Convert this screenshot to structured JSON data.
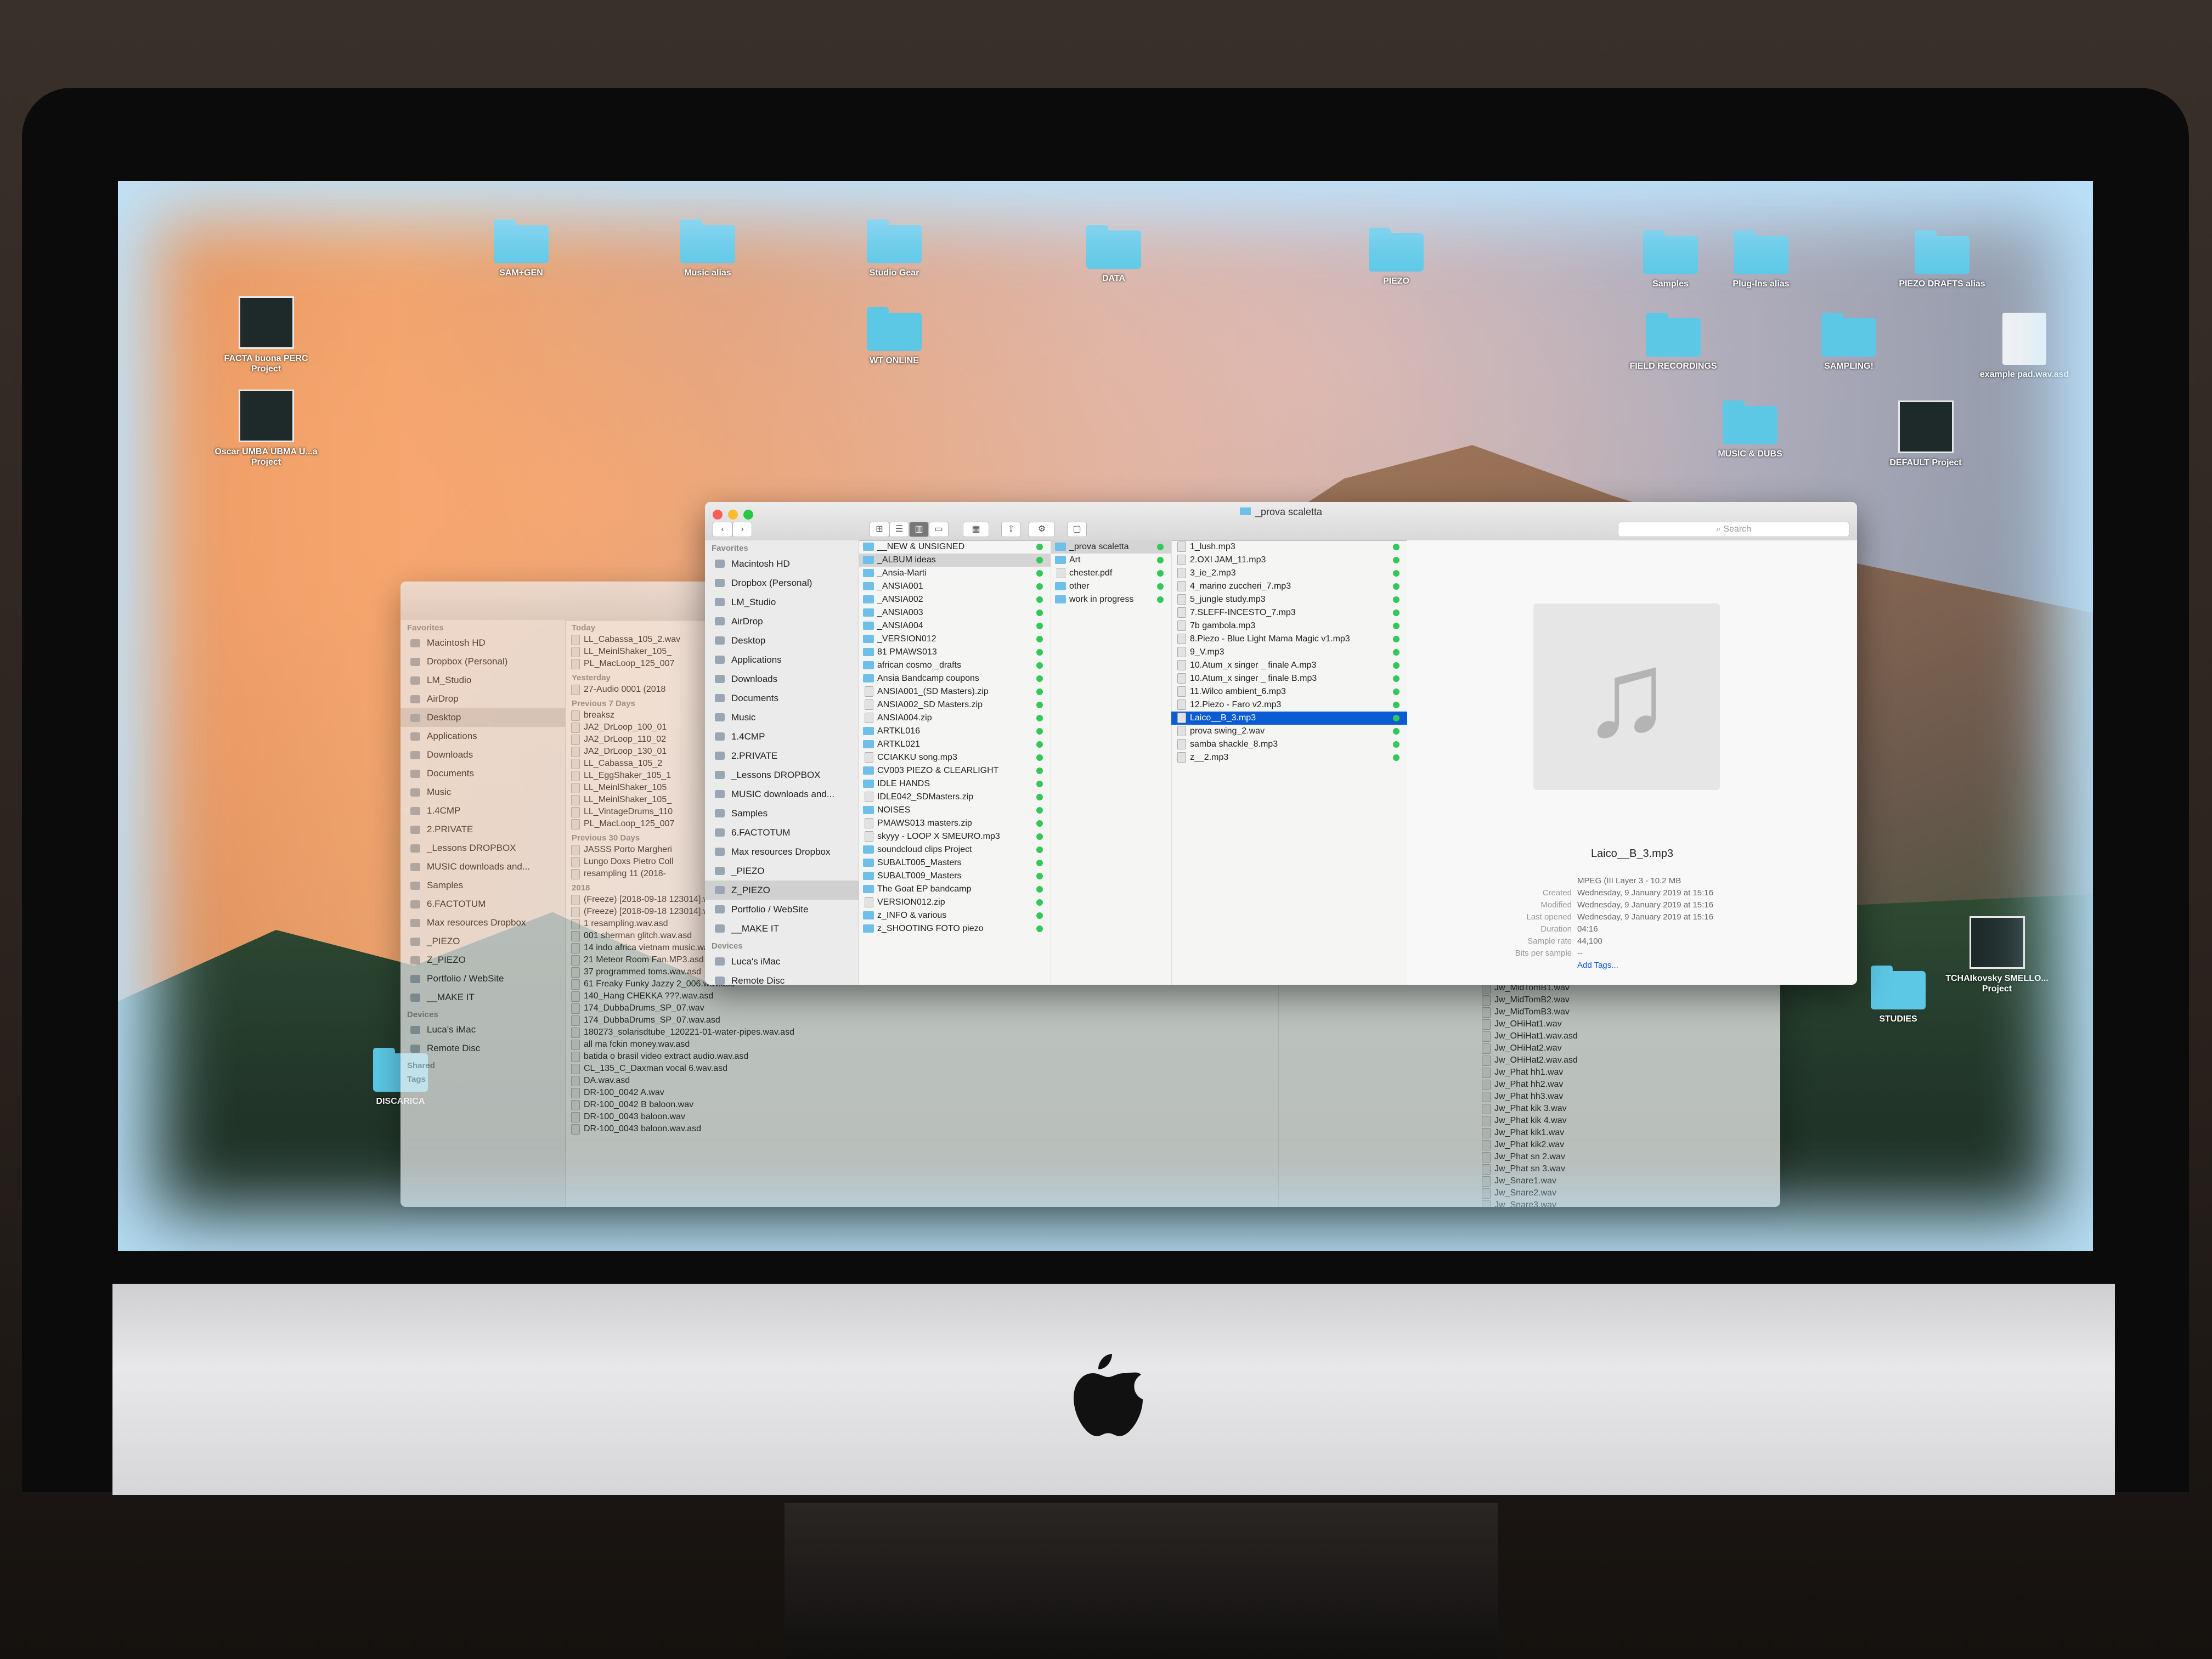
{
  "window": {
    "title": "_prova scaletta",
    "search_placeholder": "Search",
    "folder_path": "_prova scaletta"
  },
  "desktop_icons": [
    {
      "label": "SAM+GEN",
      "kind": "folder"
    },
    {
      "label": "Music alias",
      "kind": "folder"
    },
    {
      "label": "Studio Gear",
      "kind": "folder"
    },
    {
      "label": "DATA",
      "kind": "folder"
    },
    {
      "label": "PIEZO",
      "kind": "folder"
    },
    {
      "label": "Samples",
      "kind": "folder"
    },
    {
      "label": "Plug-Ins alias",
      "kind": "folder"
    },
    {
      "label": "PIEZO DRAFTS alias",
      "kind": "folder"
    },
    {
      "label": "WT ONLINE",
      "kind": "folder"
    },
    {
      "label": "FIELD RECORDINGS",
      "kind": "folder"
    },
    {
      "label": "SAMPLING!",
      "kind": "folder"
    },
    {
      "label": "MUSIC & DUBS",
      "kind": "folder"
    },
    {
      "label": "DEFAULT Project",
      "kind": "project"
    },
    {
      "label": "FACTA buona PERC Project",
      "kind": "project"
    },
    {
      "label": "Oscar UMBA UBMA U...a Project",
      "kind": "project"
    },
    {
      "label": "example pad.wav.asd",
      "kind": "doc"
    },
    {
      "label": "STUDIES",
      "kind": "folder"
    },
    {
      "label": "TCHAIkovsky SMELLO... Project",
      "kind": "project"
    },
    {
      "label": "DISCARICA",
      "kind": "folder"
    }
  ],
  "sidebar": {
    "favorites_header": "Favorites",
    "favorites": [
      "Macintosh HD",
      "Dropbox (Personal)",
      "LM_Studio",
      "AirDrop",
      "Desktop",
      "Applications",
      "Downloads",
      "Documents",
      "Music",
      "1.4CMP",
      "2.PRIVATE",
      "_Lessons DROPBOX",
      "MUSIC downloads and...",
      "Samples",
      "6.FACTOTUM",
      "Max resources Dropbox",
      "_PIEZO",
      "Z_PIEZO",
      "Portfolio / WebSite",
      "__MAKE IT"
    ],
    "selected": "Z_PIEZO",
    "devices_header": "Devices",
    "devices": [
      "Luca's iMac",
      "Remote Disc"
    ]
  },
  "column1": [
    "__NEW & UNSIGNED",
    "_ALBUM ideas",
    "_Ansia-Marti",
    "_ANSIA001",
    "_ANSIA002",
    "_ANSIA003",
    "_ANSIA004",
    "_VERSION012",
    "81 PMAWS013",
    "african cosmo _drafts",
    "Ansia Bandcamp coupons",
    "ANSIA001_(SD Masters).zip",
    "ANSIA002_SD Masters.zip",
    "ANSIA004.zip",
    "ARTKL016",
    "ARTKL021",
    "CCIAKKU song.mp3",
    "CV003 PIEZO & CLEARLIGHT",
    "IDLE HANDS",
    "IDLE042_SDMasters.zip",
    "NOISES",
    "PMAWS013 masters.zip",
    "skyyy - LOOP X SMEURO.mp3",
    "soundcloud clips Project",
    "SUBALT005_Masters",
    "SUBALT009_Masters",
    "The Goat EP bandcamp",
    "VERSION012.zip",
    "z_INFO & various",
    "z_SHOOTING FOTO piezo"
  ],
  "column1_selected": "_ALBUM ideas",
  "column2": [
    "_prova scaletta",
    "Art",
    "chester.pdf",
    "other",
    "work in progress"
  ],
  "column2_selected": "_prova scaletta",
  "column3": [
    "1_lush.mp3",
    "2.OXI JAM_11.mp3",
    "3_ie_2.mp3",
    "4_marino zuccheri_7.mp3",
    "5_jungle study.mp3",
    "7.SLEFF-INCESTO_7.mp3",
    "7b gambola.mp3",
    "8.Piezo - Blue Light Mama Magic v1.mp3",
    "9_V.mp3",
    "10.Atum_x singer _ finale A.mp3",
    "10.Atum_x singer _ finale B.mp3",
    "11.Wilco ambient_6.mp3",
    "12.Piezo - Faro v2.mp3",
    "Laico__B_3.mp3",
    "prova swing_2.wav",
    "samba shackle_8.mp3",
    "z__2.mp3"
  ],
  "column3_selected": "Laico__B_3.mp3",
  "preview": {
    "name": "Laico__B_3.mp3",
    "kind": "MPEG (III Layer 3 - 10.2 MB",
    "rows": [
      {
        "k": "Created",
        "v": "Wednesday, 9 January 2019 at 15:16"
      },
      {
        "k": "Modified",
        "v": "Wednesday, 9 January 2019 at 15:16"
      },
      {
        "k": "Last opened",
        "v": "Wednesday, 9 January 2019 at 15:16"
      },
      {
        "k": "Duration",
        "v": "04:16"
      },
      {
        "k": "Sample rate",
        "v": "44,100"
      },
      {
        "k": "Bits per sample",
        "v": "--"
      }
    ],
    "add_tags": "Add Tags..."
  },
  "back_window": {
    "sidebar": [
      "Macintosh HD",
      "Dropbox (Personal)",
      "LM_Studio",
      "AirDrop",
      "Desktop",
      "Applications",
      "Downloads",
      "Documents",
      "Music",
      "1.4CMP",
      "2.PRIVATE",
      "_Lessons DROPBOX",
      "MUSIC downloads and...",
      "Samples",
      "6.FACTOTUM",
      "Max resources Dropbox",
      "_PIEZO",
      "Z_PIEZO",
      "Portfolio / WebSite",
      "__MAKE IT"
    ],
    "devices": [
      "Luca's iMac",
      "Remote Disc"
    ],
    "shared_header": "Shared",
    "tags_header": "Tags",
    "sections": [
      {
        "header": "Today",
        "items": [
          "LL_Cabassa_105_2.wav",
          "LL_MeinlShaker_105_",
          "PL_MacLoop_125_007"
        ]
      },
      {
        "header": "Yesterday",
        "items": [
          "27-Audio 0001 (2018"
        ]
      },
      {
        "header": "Previous 7 Days",
        "items": [
          "breaksz",
          "JA2_DrLoop_100_01",
          "JA2_DrLoop_110_02",
          "JA2_DrLoop_130_01",
          "LL_Cabassa_105_2",
          "LL_EggShaker_105_1",
          "LL_MeinlShaker_105",
          "LL_MeinlShaker_105_",
          "LL_VintageDrums_110",
          "PL_MacLoop_125_007"
        ]
      },
      {
        "header": "Previous 30 Days",
        "items": [
          "JASSS Porto Margheri",
          "Lungo Doxs Pietro Coll",
          "resampling 11 (2018-"
        ]
      },
      {
        "header": "2018",
        "items": [
          "(Freeze) [2018-09-18 123014].wav.asd",
          "(Freeze) [2018-09-18 123014].wav.asd",
          "1 resampling.wav.asd",
          "001 sherman glitch.wav.asd",
          "14 indo africa vietnam music.wav.asd",
          "21 Meteor Room Fan.MP3.asd",
          "37 programmed toms.wav.asd",
          "61 Freaky Funky Jazzy 2_006.wav.asd",
          "140_Hang CHEKKA ???.wav.asd",
          "174_DubbaDrums_SP_07.wav",
          "174_DubbaDrums_SP_07.wav.asd",
          "180273_solarisdtube_120221-01-water-pipes.wav.asd",
          "all ma fckin money.wav.asd",
          "batida o brasil video extract audio.wav.asd",
          "CL_135_C_Daxman vocal 6.wav.asd",
          "DA.wav.asd",
          "DR-100_0042 A.wav",
          "DR-100_0042 B baloon.wav",
          "DR-100_0043 baloon.wav",
          "DR-100_0043 baloon.wav.asd"
        ]
      }
    ],
    "right_column": [
      "Jw_MidTomB1.wav",
      "Jw_MidTomB2.wav",
      "Jw_MidTomB3.wav",
      "Jw_OHiHat1.wav",
      "Jw_OHiHat1.wav.asd",
      "Jw_OHiHat2.wav",
      "Jw_OHiHat2.wav.asd",
      "Jw_Phat hh1.wav",
      "Jw_Phat hh2.wav",
      "Jw_Phat hh3.wav",
      "Jw_Phat kik 3.wav",
      "Jw_Phat kik 4.wav",
      "Jw_Phat kik1.wav",
      "Jw_Phat kik2.wav",
      "Jw_Phat sn 2.wav",
      "Jw_Phat sn 3.wav",
      "Jw_Snare1.wav",
      "Jw_Snare2.wav",
      "Jw_Snare3.wav"
    ]
  },
  "colors": {
    "selection": "#0b5bd3",
    "tag_green": "#34c759",
    "folder": "#5cc8e6"
  }
}
